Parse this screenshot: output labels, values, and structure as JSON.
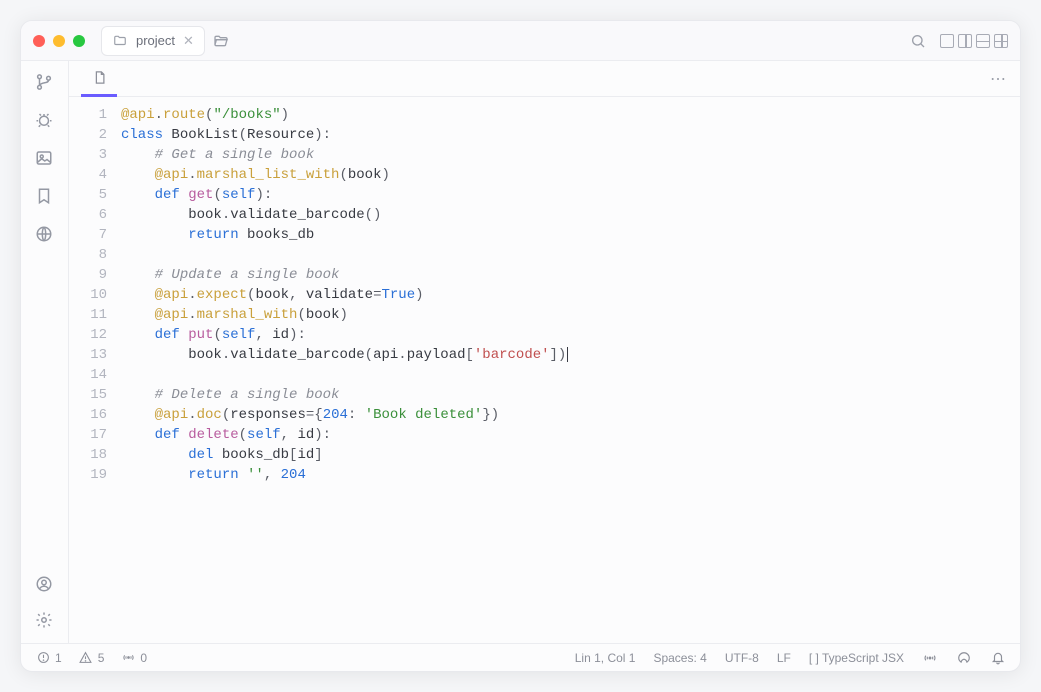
{
  "titlebar": {
    "project_tab": "project"
  },
  "sidebar_icons": [
    "branch",
    "bug",
    "image",
    "bookmark",
    "globe"
  ],
  "sidebar_bottom_icons": [
    "user",
    "settings"
  ],
  "code": {
    "lines": [
      {
        "n": 1,
        "segs": [
          [
            "tok-decor",
            "@api"
          ],
          [
            "tok-punc",
            "."
          ],
          [
            "tok-decor",
            "route"
          ],
          [
            "tok-punc",
            "("
          ],
          [
            "tok-str",
            "\"/books\""
          ],
          [
            "tok-punc",
            ")"
          ]
        ]
      },
      {
        "n": 2,
        "segs": [
          [
            "tok-kw",
            "class "
          ],
          [
            "tok-cls",
            "BookList"
          ],
          [
            "tok-punc",
            "("
          ],
          [
            "tok-var",
            "Resource"
          ],
          [
            "tok-punc",
            "):"
          ]
        ]
      },
      {
        "n": 3,
        "segs": [
          [
            "tok-var",
            "    "
          ],
          [
            "tok-comment",
            "# Get a single book"
          ]
        ]
      },
      {
        "n": 4,
        "segs": [
          [
            "tok-var",
            "    "
          ],
          [
            "tok-decor",
            "@api"
          ],
          [
            "tok-punc",
            "."
          ],
          [
            "tok-decor",
            "marshal_list_with"
          ],
          [
            "tok-punc",
            "("
          ],
          [
            "tok-var",
            "book"
          ],
          [
            "tok-punc",
            ")"
          ]
        ]
      },
      {
        "n": 5,
        "segs": [
          [
            "tok-var",
            "    "
          ],
          [
            "tok-kw",
            "def "
          ],
          [
            "tok-fn",
            "get"
          ],
          [
            "tok-punc",
            "("
          ],
          [
            "tok-kw",
            "self"
          ],
          [
            "tok-punc",
            "):"
          ]
        ]
      },
      {
        "n": 6,
        "segs": [
          [
            "tok-var",
            "        book"
          ],
          [
            "tok-punc",
            "."
          ],
          [
            "tok-var",
            "validate_barcode"
          ],
          [
            "tok-punc",
            "()"
          ]
        ]
      },
      {
        "n": 7,
        "segs": [
          [
            "tok-var",
            "        "
          ],
          [
            "tok-kw",
            "return "
          ],
          [
            "tok-var",
            "books_db"
          ]
        ]
      },
      {
        "n": 8,
        "segs": [
          [
            "tok-var",
            ""
          ]
        ]
      },
      {
        "n": 9,
        "segs": [
          [
            "tok-var",
            "    "
          ],
          [
            "tok-comment",
            "# Update a single book"
          ]
        ]
      },
      {
        "n": 10,
        "segs": [
          [
            "tok-var",
            "    "
          ],
          [
            "tok-decor",
            "@api"
          ],
          [
            "tok-punc",
            "."
          ],
          [
            "tok-decor",
            "expect"
          ],
          [
            "tok-punc",
            "("
          ],
          [
            "tok-var",
            "book"
          ],
          [
            "tok-punc",
            ", "
          ],
          [
            "tok-var",
            "validate"
          ],
          [
            "tok-punc",
            "="
          ],
          [
            "tok-bool",
            "True"
          ],
          [
            "tok-punc",
            ")"
          ]
        ]
      },
      {
        "n": 11,
        "segs": [
          [
            "tok-var",
            "    "
          ],
          [
            "tok-decor",
            "@api"
          ],
          [
            "tok-punc",
            "."
          ],
          [
            "tok-decor",
            "marshal_with"
          ],
          [
            "tok-punc",
            "("
          ],
          [
            "tok-var",
            "book"
          ],
          [
            "tok-punc",
            ")"
          ]
        ]
      },
      {
        "n": 12,
        "segs": [
          [
            "tok-var",
            "    "
          ],
          [
            "tok-kw",
            "def "
          ],
          [
            "tok-fn",
            "put"
          ],
          [
            "tok-punc",
            "("
          ],
          [
            "tok-kw",
            "self"
          ],
          [
            "tok-punc",
            ", "
          ],
          [
            "tok-var",
            "id"
          ],
          [
            "tok-punc",
            "):"
          ]
        ]
      },
      {
        "n": 13,
        "segs": [
          [
            "tok-var",
            "        book"
          ],
          [
            "tok-punc",
            "."
          ],
          [
            "tok-var",
            "validate_barcode"
          ],
          [
            "tok-punc",
            "("
          ],
          [
            "tok-var",
            "api"
          ],
          [
            "tok-punc",
            "."
          ],
          [
            "tok-var",
            "payload"
          ],
          [
            "tok-punc",
            "["
          ],
          [
            "tok-strq",
            "'barcode'"
          ],
          [
            "tok-punc",
            "])"
          ]
        ],
        "cursor": true
      },
      {
        "n": 14,
        "segs": [
          [
            "tok-var",
            ""
          ]
        ]
      },
      {
        "n": 15,
        "segs": [
          [
            "tok-var",
            "    "
          ],
          [
            "tok-comment",
            "# Delete a single book"
          ]
        ]
      },
      {
        "n": 16,
        "segs": [
          [
            "tok-var",
            "    "
          ],
          [
            "tok-decor",
            "@api"
          ],
          [
            "tok-punc",
            "."
          ],
          [
            "tok-decor",
            "doc"
          ],
          [
            "tok-punc",
            "("
          ],
          [
            "tok-var",
            "responses"
          ],
          [
            "tok-punc",
            "={"
          ],
          [
            "tok-num",
            "204"
          ],
          [
            "tok-punc",
            ": "
          ],
          [
            "tok-str",
            "'Book deleted'"
          ],
          [
            "tok-punc",
            "})"
          ]
        ]
      },
      {
        "n": 17,
        "segs": [
          [
            "tok-var",
            "    "
          ],
          [
            "tok-kw",
            "def "
          ],
          [
            "tok-fn",
            "delete"
          ],
          [
            "tok-punc",
            "("
          ],
          [
            "tok-kw",
            "self"
          ],
          [
            "tok-punc",
            ", "
          ],
          [
            "tok-var",
            "id"
          ],
          [
            "tok-punc",
            "):"
          ]
        ]
      },
      {
        "n": 18,
        "segs": [
          [
            "tok-var",
            "        "
          ],
          [
            "tok-kw",
            "del "
          ],
          [
            "tok-var",
            "books_db"
          ],
          [
            "tok-punc",
            "["
          ],
          [
            "tok-var",
            "id"
          ],
          [
            "tok-punc",
            "]"
          ]
        ]
      },
      {
        "n": 19,
        "segs": [
          [
            "tok-var",
            "        "
          ],
          [
            "tok-kw",
            "return "
          ],
          [
            "tok-str",
            "''"
          ],
          [
            "tok-punc",
            ", "
          ],
          [
            "tok-num",
            "204"
          ]
        ]
      }
    ]
  },
  "status": {
    "errors": "1",
    "warnings": "5",
    "signal": "0",
    "cursor": "Lin 1, Col 1",
    "spaces": "Spaces: 4",
    "encoding": "UTF-8",
    "lineend": "LF",
    "language": "[ ] TypeScript JSX"
  }
}
